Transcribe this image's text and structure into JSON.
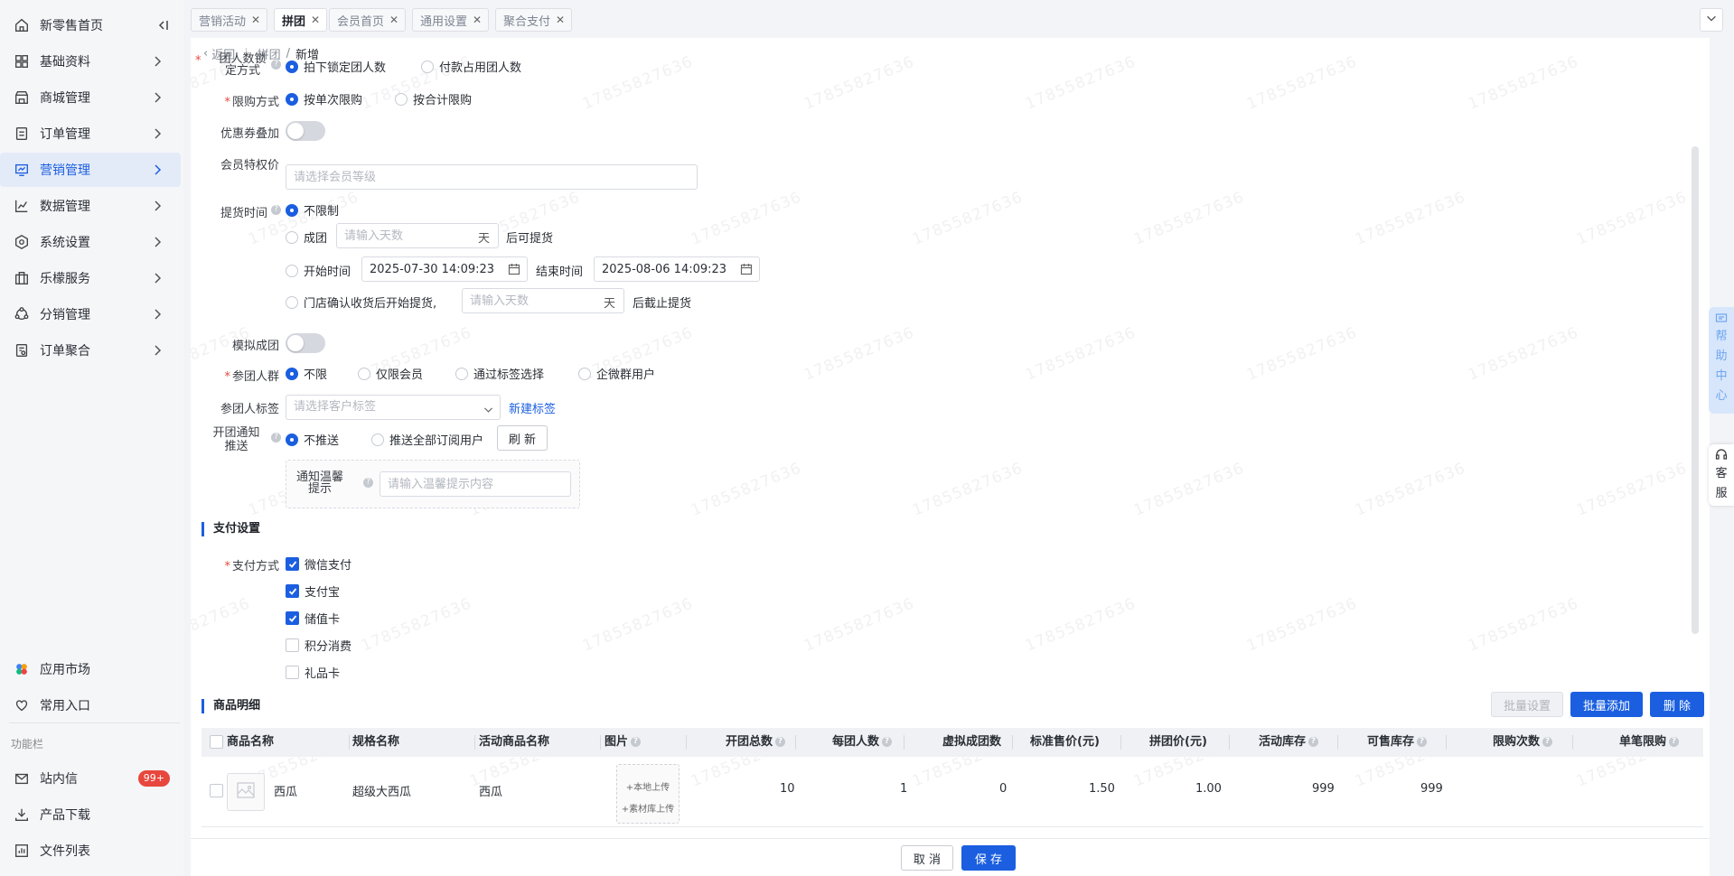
{
  "sidebar": {
    "items": [
      {
        "label": "新零售首页",
        "icon": "home-icon"
      },
      {
        "label": "基础资料",
        "icon": "grid-icon"
      },
      {
        "label": "商城管理",
        "icon": "store-icon"
      },
      {
        "label": "订单管理",
        "icon": "order-icon"
      },
      {
        "label": "营销管理",
        "icon": "marketing-icon"
      },
      {
        "label": "数据管理",
        "icon": "chart-icon"
      },
      {
        "label": "系统设置",
        "icon": "settings-icon"
      },
      {
        "label": "乐檬服务",
        "icon": "service-icon"
      },
      {
        "label": "分销管理",
        "icon": "distribution-icon"
      },
      {
        "label": "订单聚合",
        "icon": "aggregate-icon"
      }
    ],
    "bottom": [
      {
        "label": "应用市场",
        "icon": "app-market-icon"
      },
      {
        "label": "常用入口",
        "icon": "heart-icon"
      }
    ],
    "section_label": "功能栏",
    "func": [
      {
        "label": "站内信",
        "icon": "mail-icon",
        "badge": "99+"
      },
      {
        "label": "产品下载",
        "icon": "download-icon"
      },
      {
        "label": "文件列表",
        "icon": "file-list-icon"
      }
    ]
  },
  "tabs": [
    "营销活动",
    "拼团",
    "会员首页",
    "通用设置",
    "聚合支付"
  ],
  "breadcrumb": {
    "back": "返回",
    "parent": "拼团",
    "sep": "/",
    "current": "新增"
  },
  "watermark": "17855827636",
  "form": {
    "lock_mode": {
      "label1": "团人数锁",
      "label2": "定方式",
      "options": [
        "拍下锁定团人数",
        "付款占用团人数"
      ]
    },
    "limit_mode": {
      "label": "限购方式",
      "options": [
        "按单次限购",
        "按合计限购"
      ]
    },
    "coupon_stack": {
      "label": "优惠券叠加"
    },
    "member_price": {
      "label": "会员特权价",
      "placeholder": "请选择会员等级"
    },
    "pickup": {
      "label": "提货时间",
      "opt_unlimited": "不限制",
      "opt_group": "成团",
      "days_placeholder": "请输入天数",
      "unit": "天",
      "after_group": "后可提货",
      "opt_range": "开始时间",
      "start": "2025-07-30 14:09:23",
      "end_label": "结束时间",
      "end": "2025-08-06 14:09:23",
      "opt_store": "门店确认收货后开始提货,",
      "after_store": "后截止提货"
    },
    "simulate": {
      "label": "模拟成团"
    },
    "audience": {
      "label": "参团人群",
      "options": [
        "不限",
        "仅限会员",
        "通过标签选择",
        "企微群用户"
      ]
    },
    "tag": {
      "label": "参团人标签",
      "placeholder": "请选择客户标签",
      "new_link": "新建标签"
    },
    "notify": {
      "label1": "开团通知",
      "label2": "推送",
      "options": [
        "不推送",
        "推送全部订阅用户"
      ],
      "refresh": "刷 新"
    },
    "tip": {
      "label1": "通知温馨",
      "label2": "提示",
      "placeholder": "请输入温馨提示内容"
    }
  },
  "payment": {
    "title": "支付设置",
    "label": "支付方式",
    "methods": [
      {
        "name": "微信支付",
        "checked": true
      },
      {
        "name": "支付宝",
        "checked": true
      },
      {
        "name": "储值卡",
        "checked": true
      },
      {
        "name": "积分消费",
        "checked": false
      },
      {
        "name": "礼品卡",
        "checked": false
      }
    ]
  },
  "goods": {
    "title": "商品明细",
    "btn_batch_set": "批量设置",
    "btn_batch_add": "批量添加",
    "btn_delete": "删 除",
    "columns": [
      "商品名称",
      "规格名称",
      "活动商品名称",
      "图片",
      "开团总数",
      "每团人数",
      "虚拟成团数",
      "标准售价(元)",
      "拼团价(元)",
      "活动库存",
      "可售库存",
      "限购次数",
      "单笔限购"
    ],
    "rows": [
      {
        "name": "西瓜",
        "spec": "超级大西瓜",
        "activity_name": "西瓜",
        "upload_local": "+本地上传",
        "upload_lib": "+素材库上传",
        "total": "10",
        "per_group": "1",
        "virtual": "0",
        "std_price": "1.50",
        "group_price": "1.00",
        "activity_stock": "999",
        "sale_stock": "999"
      }
    ]
  },
  "footer": {
    "cancel": "取 消",
    "save": "保 存"
  },
  "helpbar": [
    "帮",
    "助",
    "中",
    "心"
  ],
  "service": [
    "客",
    "服"
  ],
  "colors": {
    "primary": "#1b5fe0",
    "danger": "#e8473e",
    "sidebar_bg": "#f5f6f8"
  }
}
